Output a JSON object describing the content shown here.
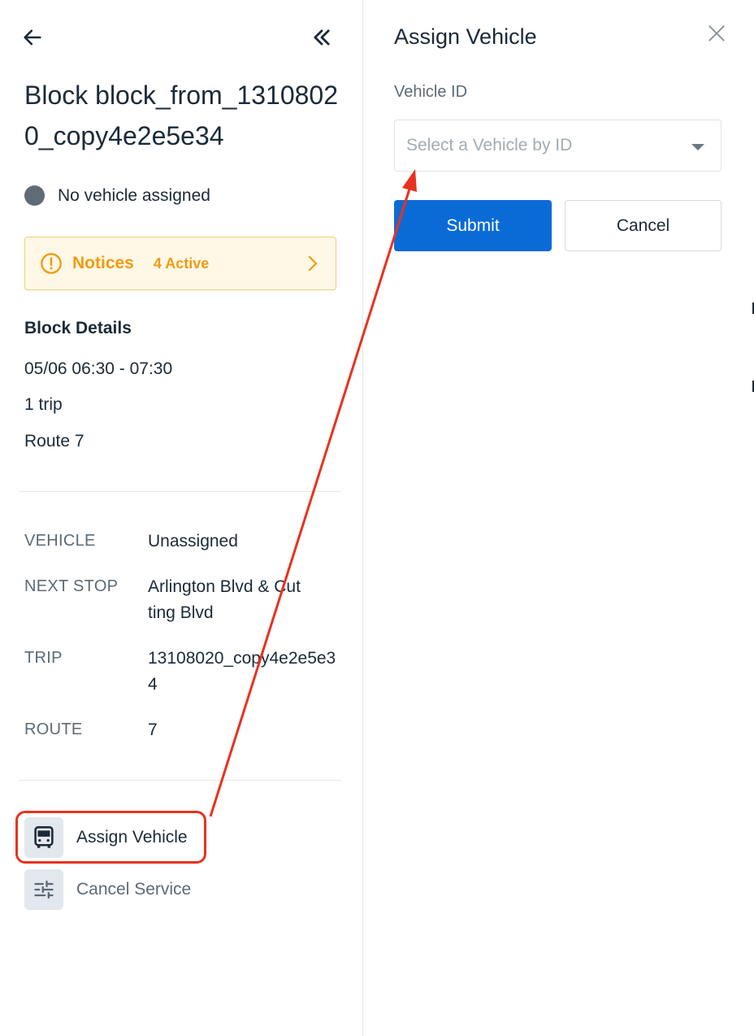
{
  "block_panel": {
    "title": "Block block_from_13108020_copy4e2e5e34",
    "status_text": "No vehicle assigned",
    "notices": {
      "label": "Notices",
      "count_text": "4 Active"
    },
    "details_title": "Block Details",
    "details": [
      "05/06 06:30 - 07:30",
      "1 trip",
      "Route 7"
    ],
    "fields": [
      {
        "key": "VEHICLE",
        "value": "Unassigned"
      },
      {
        "key": "NEXT STOP",
        "value": "Arlington Blvd & Cutting Blvd"
      },
      {
        "key": "TRIP",
        "value": "13108020_copy4e2e5e34"
      },
      {
        "key": "ROUTE",
        "value": "7"
      }
    ],
    "actions": [
      {
        "label": "Assign Vehicle",
        "icon": "bus-icon"
      },
      {
        "label": "Cancel Service",
        "icon": "sliders-icon"
      }
    ]
  },
  "assign_panel": {
    "title": "Assign Vehicle",
    "field_label": "Vehicle ID",
    "select_placeholder": "Select a Vehicle by ID",
    "submit_label": "Submit",
    "cancel_label": "Cancel"
  },
  "colors": {
    "primary": "#0b6bd6",
    "notice": "#f29b0f",
    "annotation": "#e8321f",
    "status_dot": "#5f6c76"
  }
}
